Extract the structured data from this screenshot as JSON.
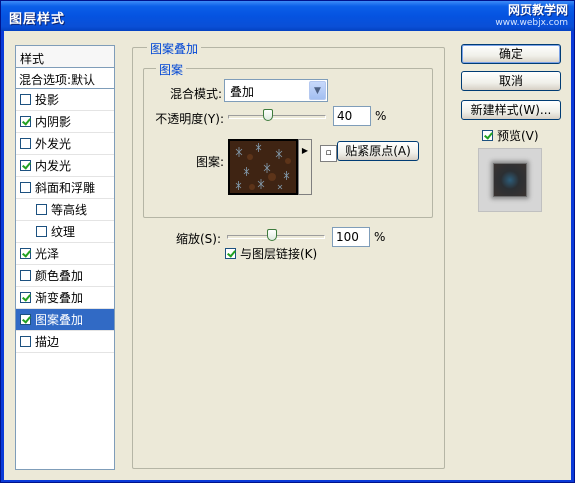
{
  "window": {
    "title": "图层样式",
    "watermark_line1": "网页教学网",
    "watermark_line2": "www.webjx.com"
  },
  "style_list": {
    "header": "样式",
    "blend_options": "混合选项:默认",
    "items": [
      {
        "label": "投影",
        "checked": false,
        "indent": false,
        "selected": false
      },
      {
        "label": "内阴影",
        "checked": true,
        "indent": false,
        "selected": false
      },
      {
        "label": "外发光",
        "checked": false,
        "indent": false,
        "selected": false
      },
      {
        "label": "内发光",
        "checked": true,
        "indent": false,
        "selected": false
      },
      {
        "label": "斜面和浮雕",
        "checked": false,
        "indent": false,
        "selected": false
      },
      {
        "label": "等高线",
        "checked": false,
        "indent": true,
        "selected": false
      },
      {
        "label": "纹理",
        "checked": false,
        "indent": true,
        "selected": false
      },
      {
        "label": "光泽",
        "checked": true,
        "indent": false,
        "selected": false
      },
      {
        "label": "颜色叠加",
        "checked": false,
        "indent": false,
        "selected": false
      },
      {
        "label": "渐变叠加",
        "checked": true,
        "indent": false,
        "selected": false
      },
      {
        "label": "图案叠加",
        "checked": true,
        "indent": false,
        "selected": true
      },
      {
        "label": "描边",
        "checked": false,
        "indent": false,
        "selected": false
      }
    ]
  },
  "panel": {
    "group_title": "图案叠加",
    "subgroup_title": "图案",
    "blend_mode_label": "混合模式:",
    "blend_mode_value": "叠加",
    "opacity_label": "不透明度(Y):",
    "opacity_value": "40",
    "opacity_unit": "%",
    "pattern_label": "图案:",
    "snap_origin_button": "贴紧原点(A)",
    "scale_label": "缩放(S):",
    "scale_value": "100",
    "scale_unit": "%",
    "link_label": "与图层链接(K)",
    "link_checked": true
  },
  "buttons": {
    "ok": "确定",
    "cancel": "取消",
    "new_style": "新建样式(W)...",
    "preview_label": "预览(V)",
    "preview_checked": true
  },
  "colors": {
    "title_bar": "#0553e1",
    "selected": "#316ac5",
    "dialog_bg": "#ece9d8",
    "legend_text": "#0046d5"
  }
}
